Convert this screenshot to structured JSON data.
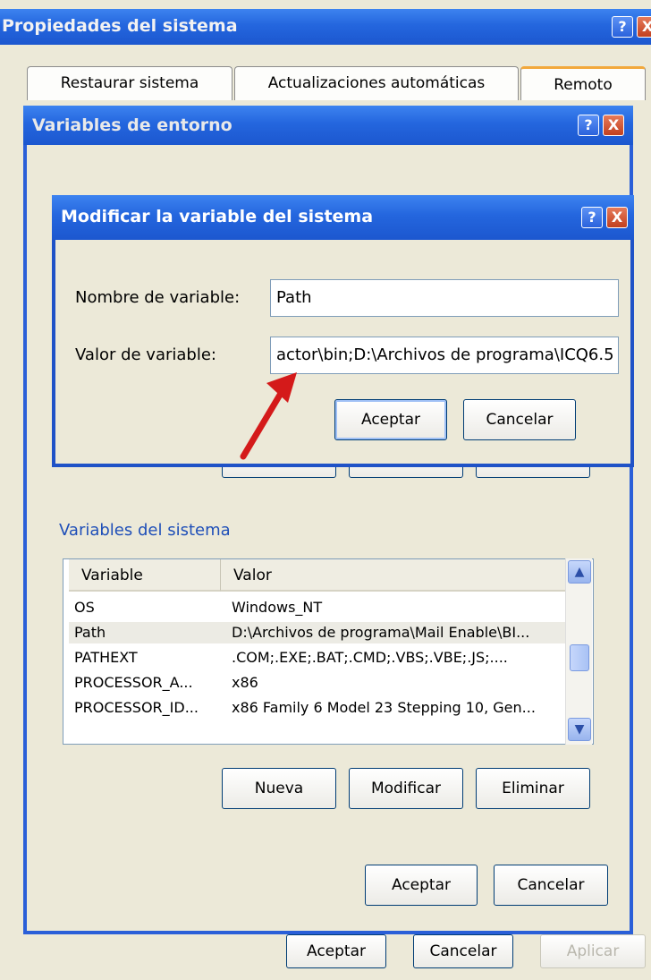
{
  "system_properties": {
    "title": "Propiedades del sistema",
    "help": "?",
    "close": "X",
    "tabs": [
      "Restaurar sistema",
      "Actualizaciones automáticas",
      "Remoto"
    ],
    "buttons": {
      "ok": "Aceptar",
      "cancel": "Cancelar",
      "apply": "Aplicar"
    }
  },
  "env_vars": {
    "title": "Variables de entorno",
    "help": "?",
    "close": "X",
    "system_section_label": "Variables del sistema",
    "columns": [
      "Variable",
      "Valor"
    ],
    "rows": [
      {
        "name": "OS",
        "value": "Windows_NT"
      },
      {
        "name": "Path",
        "value": "D:\\Archivos de programa\\Mail Enable\\BI..."
      },
      {
        "name": "PATHEXT",
        "value": ".COM;.EXE;.BAT;.CMD;.VBS;.VBE;.JS;...."
      },
      {
        "name": "PROCESSOR_A...",
        "value": "x86"
      },
      {
        "name": "PROCESSOR_ID...",
        "value": "x86 Family 6 Model 23 Stepping 10, Gen..."
      }
    ],
    "buttons": {
      "new": "Nueva",
      "edit": "Modificar",
      "delete": "Eliminar",
      "ok": "Aceptar",
      "cancel": "Cancelar"
    }
  },
  "edit_dialog": {
    "title": "Modificar la variable del sistema",
    "help": "?",
    "close": "X",
    "name_label": "Nombre de variable:",
    "name_value": "Path",
    "value_label": "Valor de variable:",
    "value_value": "actor\\bin;D:\\Archivos de programa\\ICQ6.5",
    "buttons": {
      "ok": "Aceptar",
      "cancel": "Cancelar"
    }
  },
  "annotation": {
    "arrow_color": "#d41a1a"
  }
}
